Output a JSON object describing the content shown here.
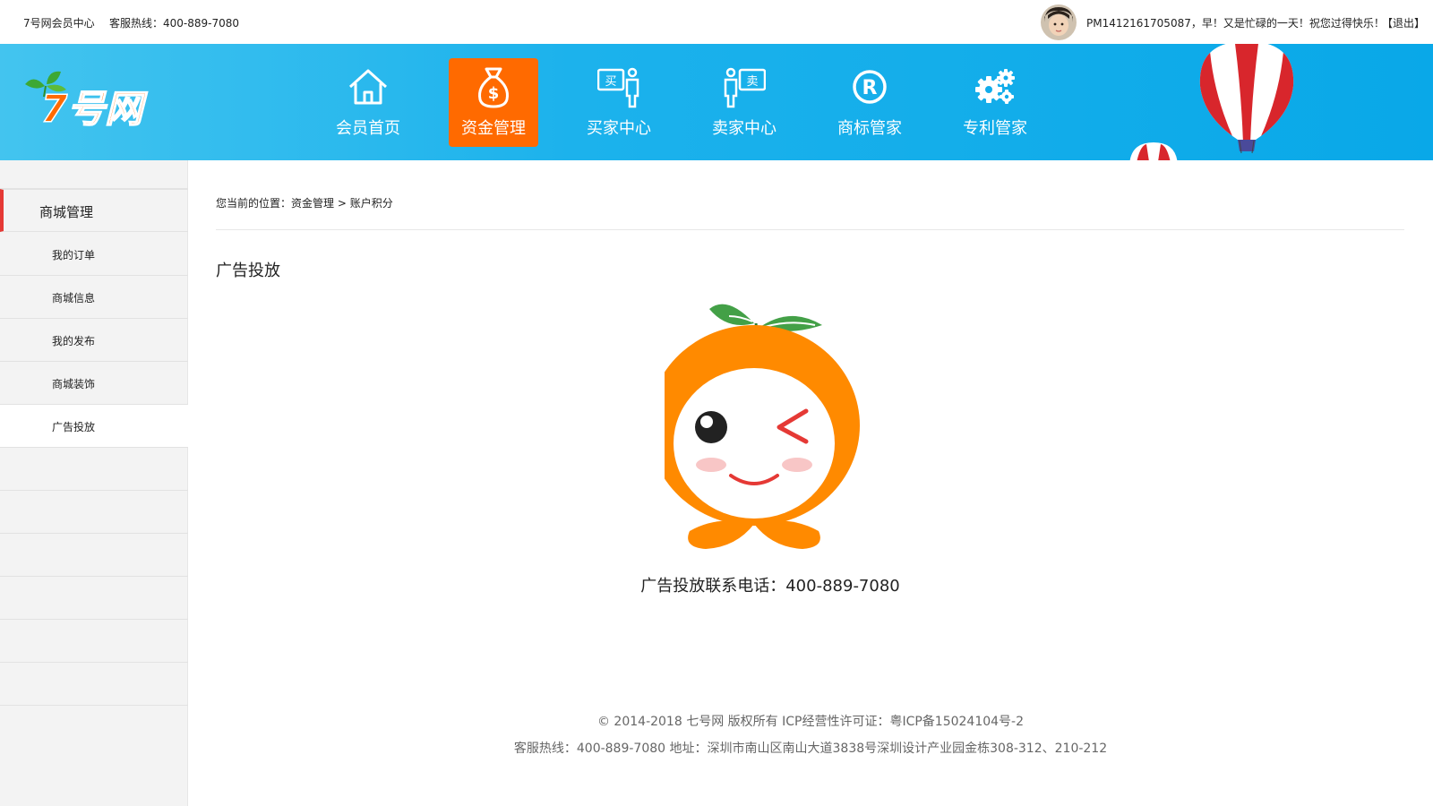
{
  "topbar": {
    "site_name": "7号网会员中心",
    "hotline": "客服热线：400-889-7080",
    "greeting": "PM1412161705087，早！又是忙碌的一天！祝您过得快乐！",
    "logout": "【退出】"
  },
  "header": {
    "logo_text": "7号网",
    "nav": [
      {
        "label": "会员首页",
        "icon": "home-icon"
      },
      {
        "label": "资金管理",
        "icon": "money-bag-icon",
        "active": true
      },
      {
        "label": "买家中心",
        "icon": "buyer-icon",
        "icon_text": "买"
      },
      {
        "label": "卖家中心",
        "icon": "seller-icon",
        "icon_text": "卖"
      },
      {
        "label": "商标管家",
        "icon": "registered-trademark-icon"
      },
      {
        "label": "专利管家",
        "icon": "gears-icon"
      }
    ],
    "active_color": "#ff6a00"
  },
  "sidebar": {
    "group_title": "商城管理",
    "items": [
      {
        "label": "我的订单"
      },
      {
        "label": "商城信息"
      },
      {
        "label": "我的发布"
      },
      {
        "label": "商城装饰"
      },
      {
        "label": "广告投放",
        "active": true
      }
    ],
    "accent_color": "#e53935"
  },
  "main": {
    "breadcrumb": {
      "prefix": "您当前的位置：",
      "level1": "资金管理",
      "separator": " > ",
      "level2": "账户积分"
    },
    "title": "广告投放",
    "mascot": "orange-mascot-icon",
    "contact": "广告投放联系电话：400-889-7080"
  },
  "footer": {
    "copyright": "© 2014-2018 七号网 版权所有 ICP经营性许可证：粤ICP备15024104号-2",
    "address": "客服热线：400-889-7080  地址：深圳市南山区南山大道3838号深圳设计产业园金栋308-312、210-212"
  }
}
